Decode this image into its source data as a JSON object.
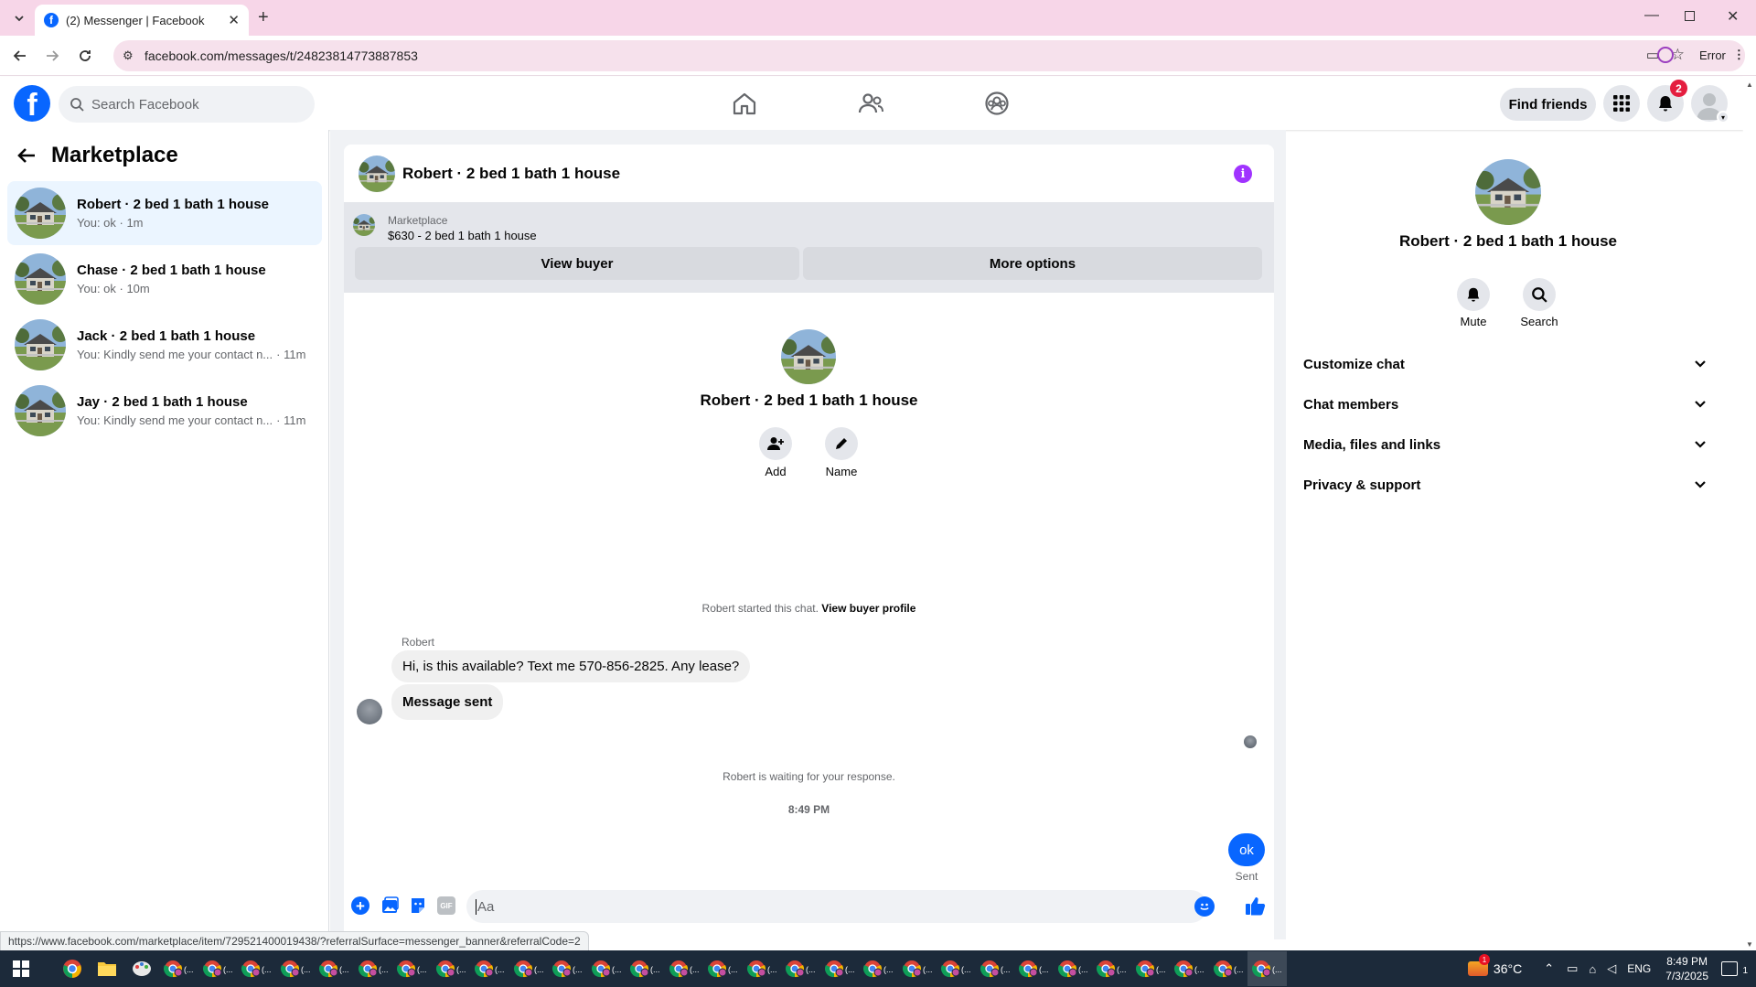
{
  "browser": {
    "tab_title": "(2) Messenger | Facebook",
    "url": "facebook.com/messages/t/24823814773887853",
    "profile_status": "Error",
    "status_url": "https://www.facebook.com/marketplace/item/729521400019438/?referralSurface=messenger_banner&referralCode=2"
  },
  "header": {
    "search_placeholder": "Search Facebook",
    "find_friends": "Find friends",
    "notification_count": "2"
  },
  "sidebar": {
    "title": "Marketplace",
    "conversations": [
      {
        "name": "Robert · 2 bed 1 bath 1 house",
        "preview": "You: ok · 1m",
        "active": true
      },
      {
        "name": "Chase · 2 bed 1 bath 1 house",
        "preview": "You: ok · 10m",
        "active": false
      },
      {
        "name": "Jack · 2 bed 1 bath 1 house",
        "preview": "You: Kindly send me your contact n...",
        "time": "· 11m",
        "active": false
      },
      {
        "name": "Jay · 2 bed 1 bath 1 house",
        "preview": "You: Kindly send me your contact n...",
        "time": "· 11m",
        "active": false
      }
    ]
  },
  "chat": {
    "title": "Robert · 2 bed 1 bath 1 house",
    "banner_label": "Marketplace",
    "listing": "$630 - 2 bed 1 bath 1 house",
    "view_buyer": "View buyer",
    "more_options": "More options",
    "profile_name": "Robert · 2 bed 1 bath 1 house",
    "add_label": "Add",
    "name_label": "Name",
    "started_text": "Robert started this chat.",
    "view_buyer_profile": "View buyer profile",
    "sender": "Robert",
    "messages": [
      "Hi, is this available? Text me 570-856-2825. Any lease?",
      "Message sent"
    ],
    "waiting_text": "Robert is waiting for your response.",
    "timestamp": "8:49 PM",
    "my_message": "ok",
    "my_status": "Sent",
    "composer_placeholder": "Aa",
    "gif_label": "GIF"
  },
  "details": {
    "name": "Robert · 2 bed 1 bath 1 house",
    "mute": "Mute",
    "search": "Search",
    "sections": [
      "Customize chat",
      "Chat members",
      "Media, files and links",
      "Privacy & support"
    ]
  },
  "taskbar": {
    "weather": "36°C",
    "lang": "ENG",
    "time": "8:49 PM",
    "date": "7/3/2025",
    "notif_count": "1"
  },
  "colors": {
    "brand": "#0866ff",
    "messenger_purple": "#a033ff",
    "tab_bg": "#f7d6e8"
  }
}
